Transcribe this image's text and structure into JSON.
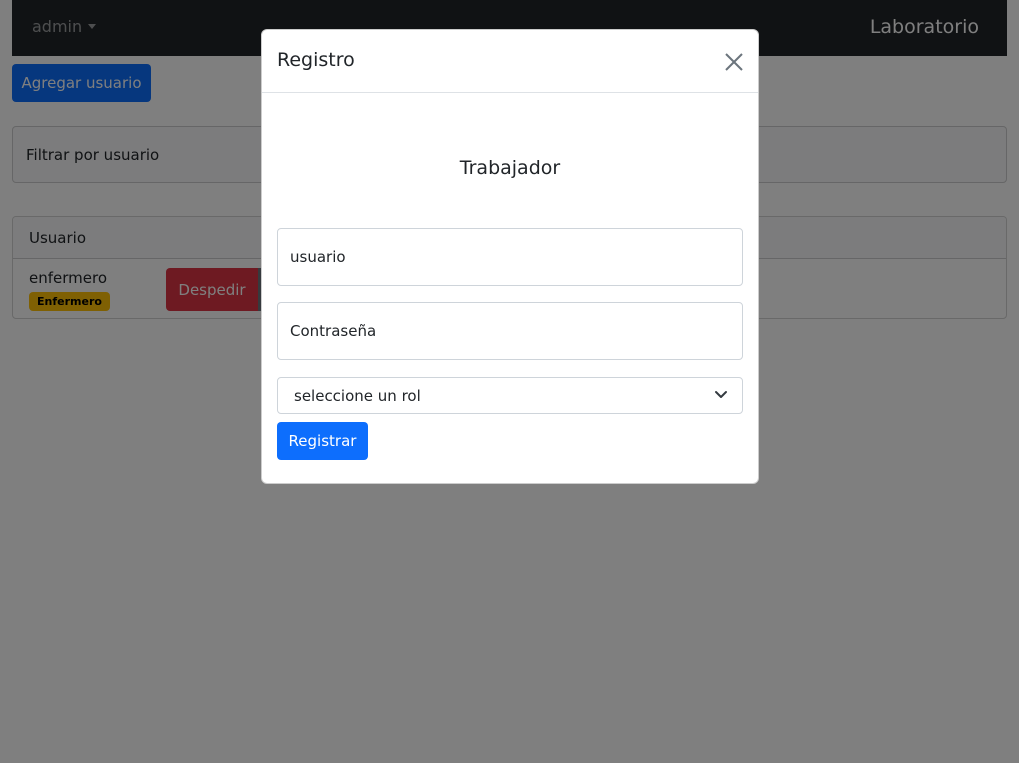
{
  "navbar": {
    "user_label": "admin",
    "brand": "Laboratorio"
  },
  "toolbar": {
    "add_user_label": "Agregar usuario"
  },
  "filter": {
    "label": "Filtrar por usuario"
  },
  "users_table": {
    "header": "Usuario",
    "rows": [
      {
        "name": "enfermero",
        "role_badge": "Enfermero",
        "fire_label": "Despedir"
      }
    ]
  },
  "modal": {
    "title": "Registro",
    "subtitle": "Trabajador",
    "username_placeholder": "usuario",
    "password_placeholder": "Contraseña",
    "role_select_value": "seleccione un rol",
    "submit_label": "Registrar"
  },
  "colors": {
    "primary": "#0d6efd",
    "danger": "#dc3545",
    "warning": "#ffc107",
    "navbar": "#212529"
  },
  "icons": {
    "close": "close-icon",
    "select_chevron": "chevron-down-icon",
    "user_caret": "caret-down-icon"
  }
}
